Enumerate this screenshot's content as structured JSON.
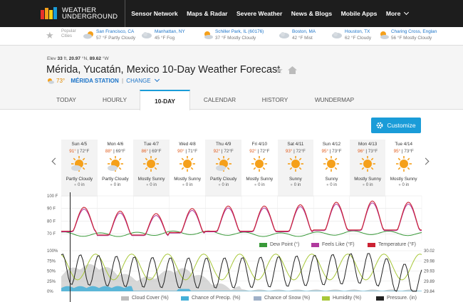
{
  "brand": {
    "line1": "WEATHER",
    "line2": "UNDERGROUND"
  },
  "nav": [
    "Sensor Network",
    "Maps & Radar",
    "Severe Weather",
    "News & Blogs",
    "Mobile Apps",
    "More"
  ],
  "popular_label": [
    "Popular",
    "Cities"
  ],
  "cities": [
    {
      "name": "San Francisco, CA",
      "wx": "57 °F Partly Cloudy",
      "icon": "partly-cloudy-icon"
    },
    {
      "name": "Manhattan, NY",
      "wx": "45 °F Fog",
      "icon": "cloudy-icon"
    },
    {
      "name": "Schiller Park, IL (60176)",
      "wx": "37 °F Mostly Cloudy",
      "icon": "partly-cloudy-icon"
    },
    {
      "name": "Boston, MA",
      "wx": "42 °F Mist",
      "icon": "cloudy-icon"
    },
    {
      "name": "Houston, TX",
      "wx": "62 °F Cloudy",
      "icon": "cloudy-icon"
    },
    {
      "name": "Charing Cross, Englan",
      "wx": "56 °F Mostly Cloudy",
      "icon": "partly-cloudy-icon"
    }
  ],
  "location": {
    "elev_label": "Elev",
    "elev": "33",
    "elev_unit": "ft,",
    "lat": "20.97",
    "lat_unit": "°N,",
    "lon": "89.62",
    "lon_unit": "°W",
    "title": "Mérida, Yucatán, Mexico 10-Day Weather Forecast",
    "temp": "73°",
    "station": "MÉRIDA STATION",
    "sep": "|",
    "change": "CHANGE"
  },
  "tabs": [
    "TODAY",
    "HOURLY",
    "10-DAY",
    "CALENDAR",
    "HISTORY",
    "WUNDERMAP"
  ],
  "active_tab": "10-DAY",
  "customize": "Customize",
  "days": [
    {
      "d": "Sun 4/5",
      "hi": "91°",
      "lo": "72°F",
      "c": "Partly Cloudy",
      "p": "0 in"
    },
    {
      "d": "Mon 4/6",
      "hi": "88°",
      "lo": "69°F",
      "c": "Partly Cloudy",
      "p": "0 in"
    },
    {
      "d": "Tue 4/7",
      "hi": "86°",
      "lo": "69°F",
      "c": "Mostly Sunny",
      "p": "0 in"
    },
    {
      "d": "Wed 4/8",
      "hi": "90°",
      "lo": "71°F",
      "c": "Mostly Sunny",
      "p": "0 in"
    },
    {
      "d": "Thu 4/9",
      "hi": "92°",
      "lo": "72°F",
      "c": "Partly Cloudy",
      "p": "0 in"
    },
    {
      "d": "Fri 4/10",
      "hi": "92°",
      "lo": "72°F",
      "c": "Mostly Sunny",
      "p": "0 in"
    },
    {
      "d": "Sat 4/11",
      "hi": "93°",
      "lo": "72°F",
      "c": "Sunny",
      "p": "0 in"
    },
    {
      "d": "Sun 4/12",
      "hi": "95°",
      "lo": "73°F",
      "c": "Sunny",
      "p": "0 in"
    },
    {
      "d": "Mon 4/13",
      "hi": "96°",
      "lo": "73°F",
      "c": "Mostly Sunny",
      "p": "0 in"
    },
    {
      "d": "Tue 4/14",
      "hi": "95°",
      "lo": "73°F",
      "c": "Mostly Sunny",
      "p": "0 in"
    }
  ],
  "chart_data": [
    {
      "type": "line",
      "ylim": [
        65,
        100
      ],
      "yticks": [
        "100 F",
        "90 F",
        "80 F",
        "70 F"
      ],
      "x_days": 10,
      "series": [
        {
          "name": "Dew Point (°)",
          "color": "#3a9a3a"
        },
        {
          "name": "Feels Like (°F)",
          "color": "#b03a9e"
        },
        {
          "name": "Temperature (°F)",
          "color": "#cc2233"
        }
      ],
      "daily_high": [
        91,
        88,
        86,
        90,
        92,
        92,
        93,
        95,
        96,
        95
      ],
      "daily_low": [
        72,
        69,
        69,
        71,
        72,
        72,
        72,
        73,
        73,
        73
      ],
      "dew_point_approx": 70
    },
    {
      "type": "area",
      "yticks_left": [
        "100%",
        "75%",
        "50%",
        "25%",
        "0%"
      ],
      "yticks_right": [
        "30.02",
        "29.98",
        "29.93",
        "29.89",
        "29.84"
      ],
      "series": [
        {
          "name": "Cloud Cover (%)",
          "color": "#bdbdbd"
        },
        {
          "name": "Chance of Precip. (%)",
          "color": "#45b0d8"
        },
        {
          "name": "Chance of Snow (%)",
          "color": "#9fb0c8"
        },
        {
          "name": "Humidity (%)",
          "color": "#a8c83a"
        },
        {
          "name": "Pressure. (in)",
          "color": "#222222"
        }
      ]
    }
  ]
}
